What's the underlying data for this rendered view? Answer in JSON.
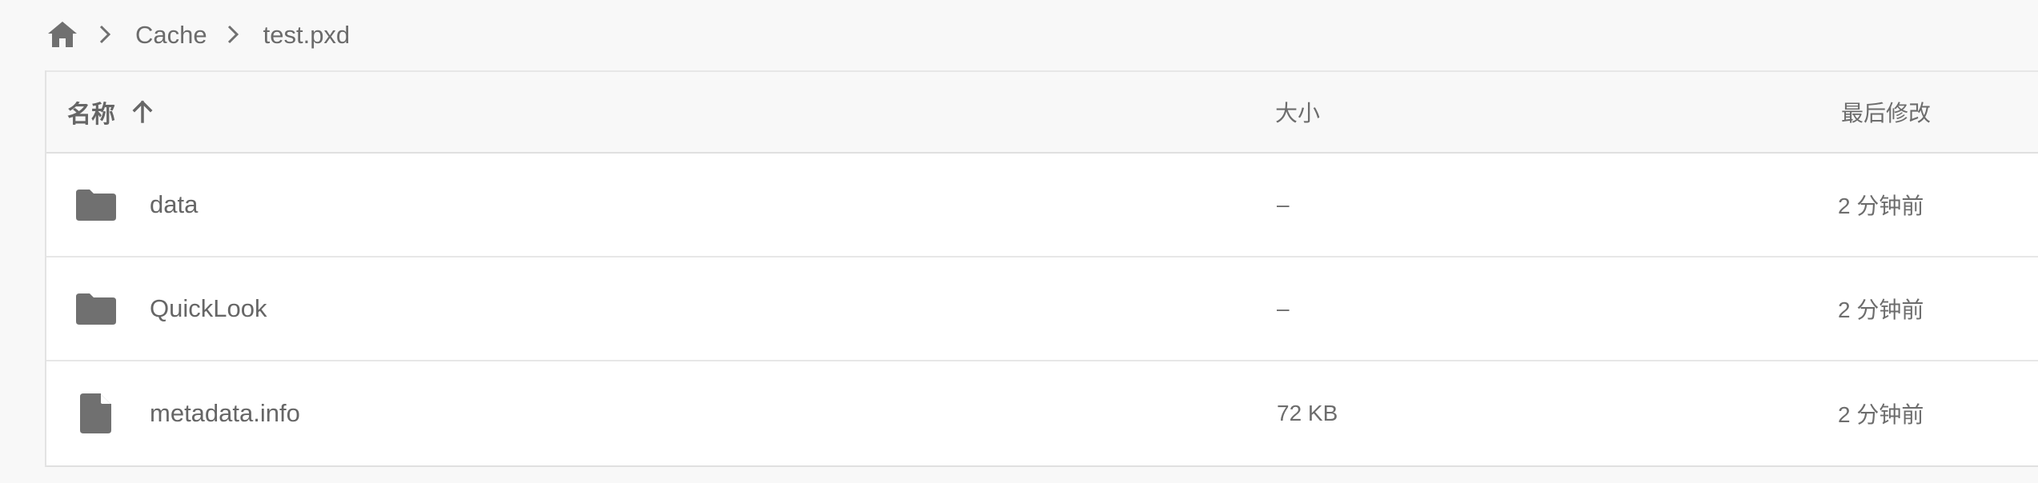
{
  "breadcrumb": {
    "home_icon": "home-icon",
    "separator_icon": "chevron-right-icon",
    "items": [
      {
        "label": "Cache"
      },
      {
        "label": "test.pxd"
      }
    ]
  },
  "table": {
    "columns": {
      "name": "名称",
      "size": "大小",
      "modified": "最后修改"
    },
    "sort_icon": "arrow-up-icon",
    "rows": [
      {
        "icon": "folder-icon",
        "name": "data",
        "size": "–",
        "modified": "2 分钟前"
      },
      {
        "icon": "folder-icon",
        "name": "QuickLook",
        "size": "–",
        "modified": "2 分钟前"
      },
      {
        "icon": "file-icon",
        "name": "metadata.info",
        "size": "72 KB",
        "modified": "2 分钟前"
      }
    ]
  },
  "colors": {
    "background": "#f8f8f8",
    "row_background": "#ffffff",
    "text": "#666666",
    "icon": "#707070",
    "border": "#e3e3e3"
  }
}
